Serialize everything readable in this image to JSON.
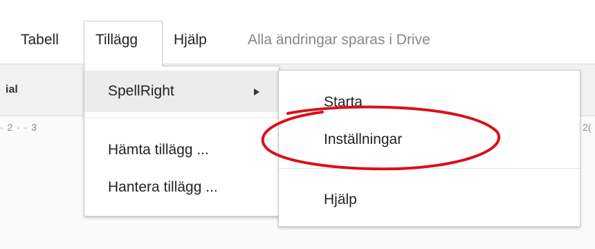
{
  "menubar": {
    "items": [
      "Tabell",
      "Tillägg",
      "Hjälp"
    ],
    "save_status": "Alla ändringar sparas i Drive"
  },
  "toolbar": {
    "font_name": "ial"
  },
  "ruler": {
    "left_marks": "· 2 · · 3",
    "right_mark": "2("
  },
  "tillagg_menu": {
    "items": [
      {
        "label": "SpellRight",
        "has_submenu": true
      },
      {
        "label": "Hämta tillägg ..."
      },
      {
        "label": "Hantera tillägg ..."
      }
    ]
  },
  "spellright_submenu": {
    "items": [
      {
        "label": "Starta"
      },
      {
        "label": "Inställningar"
      },
      {
        "label": "Hjälp"
      }
    ]
  },
  "annotation": {
    "circle_color": "#d9101a",
    "target": "Inställningar"
  },
  "colors": {
    "status_text": "#888888",
    "highlight": "#ececec",
    "toolbar_bg": "#f1f1f1"
  }
}
